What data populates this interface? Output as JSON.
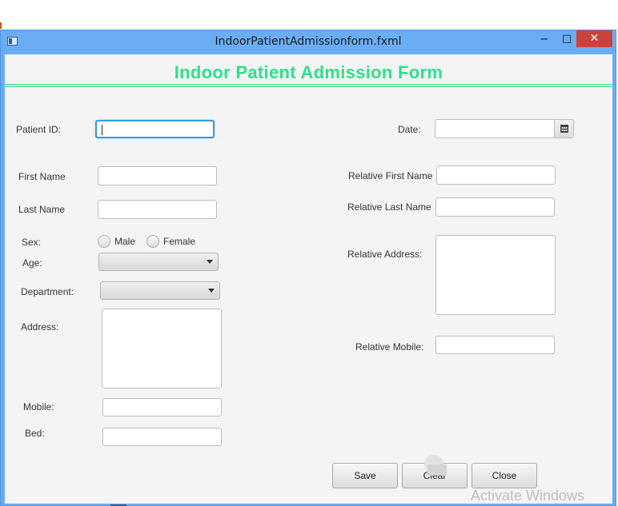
{
  "window": {
    "title": "IndoorPatientAdmissionform.fxml",
    "minimize_glyph": "−",
    "maximize_glyph": "□",
    "close_glyph": "✕"
  },
  "form": {
    "title": "Indoor Patient  Admission Form",
    "title_color": "#2ee08a",
    "patient_id_label": "Patient ID:",
    "patient_id_value": "",
    "date_label": "Date:",
    "date_value": "",
    "first_name_label": "First Name",
    "first_name_value": "",
    "last_name_label": "Last Name",
    "last_name_value": "",
    "sex_label": "Sex:",
    "sex_options": [
      "Male",
      "Female"
    ],
    "age_label": "Age:",
    "age_value": "",
    "department_label": "Department:",
    "department_value": "",
    "address_label": "Address:",
    "address_value": "",
    "mobile_label": "Mobile:",
    "mobile_value": "",
    "bed_label": "Bed:",
    "bed_value": "",
    "relative_first_name_label": "Relative First Name",
    "relative_first_name_value": "",
    "relative_last_name_label": "Relative Last Name",
    "relative_last_name_value": "",
    "relative_address_label": "Relative Address:",
    "relative_address_value": "",
    "relative_mobile_label": "Relative Mobile:",
    "relative_mobile_value": ""
  },
  "buttons": {
    "save": "Save",
    "clear": "Clear",
    "close": "Close"
  },
  "watermark": {
    "text": "Activate Windows"
  },
  "icons": {
    "window": "window-icon",
    "calendar": "calendar-icon",
    "combo": "chevron-down-icon"
  }
}
